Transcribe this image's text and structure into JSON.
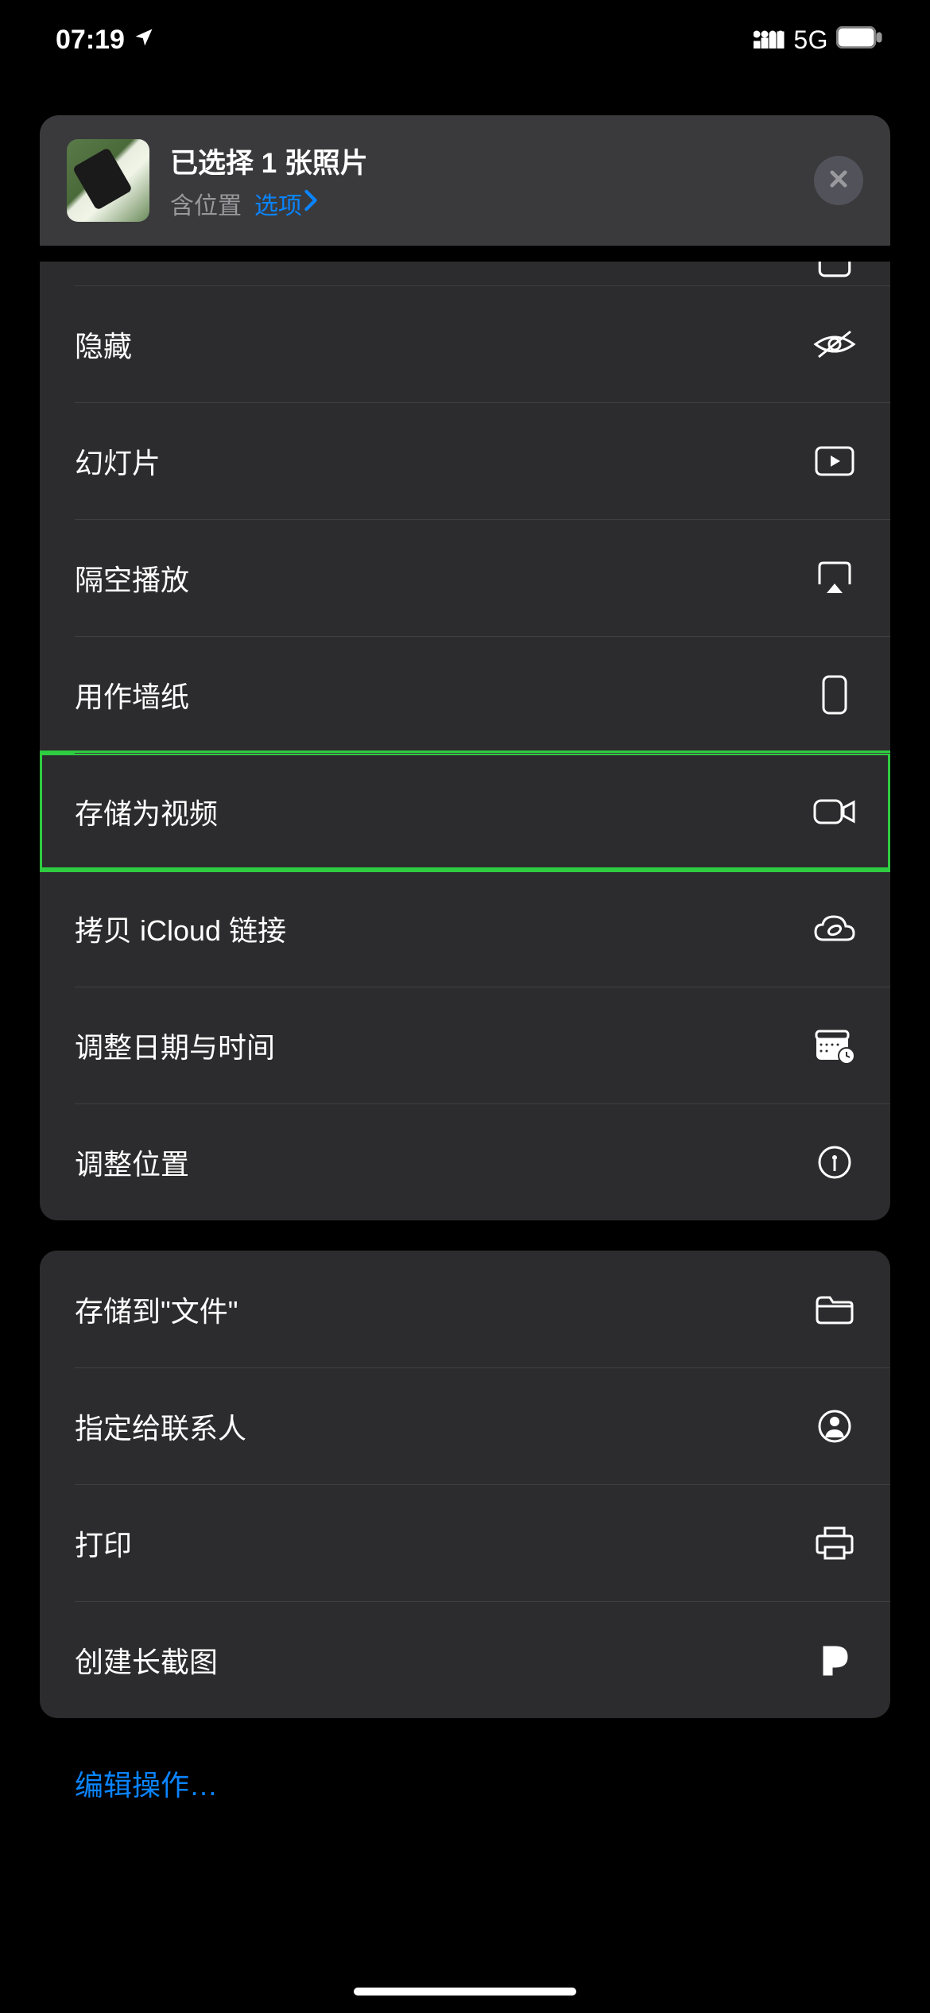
{
  "status": {
    "time": "07:19",
    "network": "5G"
  },
  "header": {
    "title": "已选择 1 张照片",
    "location_label": "含位置",
    "options_label": "选项"
  },
  "group1": {
    "hide": "隐藏",
    "slideshow": "幻灯片",
    "airplay": "隔空播放",
    "wallpaper": "用作墙纸",
    "save_video": "存储为视频",
    "icloud_link": "拷贝 iCloud 链接",
    "adjust_date": "调整日期与时间",
    "adjust_location": "调整位置"
  },
  "group2": {
    "save_files": "存储到\"文件\"",
    "assign_contact": "指定给联系人",
    "print": "打印",
    "long_screenshot": "创建长截图"
  },
  "footer": {
    "edit": "编辑操作…"
  }
}
